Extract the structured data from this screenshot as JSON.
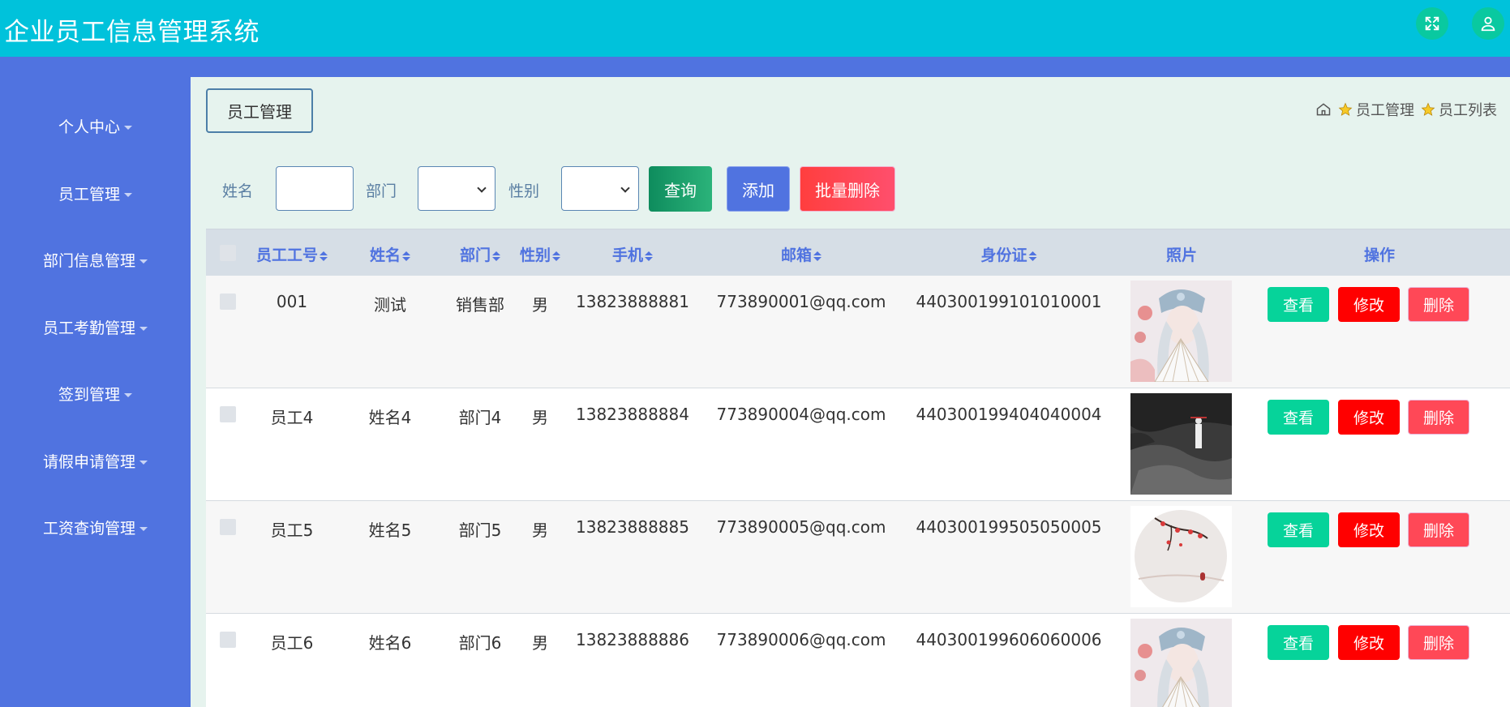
{
  "app": {
    "title": "企业员工信息管理系统"
  },
  "header": {
    "fullscreen_icon": "expand-icon",
    "user_icon": "user-icon"
  },
  "sidebar": {
    "items": [
      {
        "label": "个人中心"
      },
      {
        "label": "员工管理"
      },
      {
        "label": "部门信息管理"
      },
      {
        "label": "员工考勤管理"
      },
      {
        "label": "签到管理"
      },
      {
        "label": "请假申请管理"
      },
      {
        "label": "工资查询管理"
      }
    ]
  },
  "page": {
    "tag": "员工管理"
  },
  "breadcrumb": {
    "level1": "员工管理",
    "level2": "员工列表"
  },
  "search": {
    "name_label": "姓名",
    "name_value": "",
    "dept_label": "部门",
    "dept_value": "",
    "gender_label": "性别",
    "gender_value": "",
    "query_btn": "查询",
    "add_btn": "添加",
    "batch_delete_btn": "批量删除"
  },
  "table": {
    "headers": {
      "emp_no": "员工工号",
      "name": "姓名",
      "dept": "部门",
      "gender": "性别",
      "phone": "手机",
      "email": "邮箱",
      "id_card": "身份证",
      "photo": "照片",
      "actions": "操作"
    },
    "action_labels": {
      "view": "查看",
      "edit": "修改",
      "delete": "删除"
    },
    "rows": [
      {
        "emp_no": "001",
        "name": "测试",
        "dept": "销售部",
        "gender": "男",
        "phone": "13823888881",
        "email": "773890001@qq.com",
        "id_card": "440300199101010001",
        "photo": "opera-figure"
      },
      {
        "emp_no": "员工4",
        "name": "姓名4",
        "dept": "部门4",
        "gender": "男",
        "phone": "13823888884",
        "email": "773890004@qq.com",
        "id_card": "440300199404040004",
        "photo": "dark-landscape"
      },
      {
        "emp_no": "员工5",
        "name": "姓名5",
        "dept": "部门5",
        "gender": "男",
        "phone": "13823888885",
        "email": "773890005@qq.com",
        "id_card": "440300199505050005",
        "photo": "plum-blossom"
      },
      {
        "emp_no": "员工6",
        "name": "姓名6",
        "dept": "部门6",
        "gender": "男",
        "phone": "13823888886",
        "email": "773890006@qq.com",
        "id_card": "440300199606060006",
        "photo": "opera-figure"
      }
    ]
  },
  "colors": {
    "header_bg": "#00c2db",
    "sidebar_bg": "#5073e0",
    "main_bg": "#e6f3ee",
    "query_btn": "#1aa06b",
    "add_btn": "#5073e0",
    "danger_btn": "#ff4857",
    "view_btn": "#06d39a",
    "edit_btn": "#ff0000"
  }
}
